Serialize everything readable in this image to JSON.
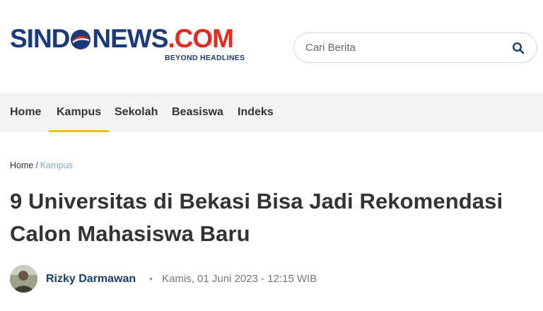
{
  "header": {
    "logo": {
      "part1": "SIND",
      "part2": "NEWS",
      "part3": ".COM",
      "tagline": "BEYOND HEADLINES"
    },
    "search": {
      "placeholder": "Cari Berita",
      "icon": "search-icon"
    }
  },
  "nav": {
    "items": [
      {
        "label": "Home"
      },
      {
        "label": "Kampus",
        "active": true
      },
      {
        "label": "Sekolah"
      },
      {
        "label": "Beasiswa"
      },
      {
        "label": "Indeks"
      }
    ]
  },
  "breadcrumb": {
    "home": "Home",
    "separator": "/",
    "current": "Kampus"
  },
  "article": {
    "title_line1": "9 Universitas di Bekasi Bisa Jadi Rekomendasi",
    "title_line2": "Calon Mahasiswa Baru",
    "author": "Rizky Darmawan",
    "separator": "•",
    "date": "Kamis, 01 Juni 2023 - 12:15 WIB"
  },
  "colors": {
    "brand_blue": "#1a3a7c",
    "brand_red": "#e52a1f",
    "nav_active_underline": "#f2c200",
    "breadcrumb_current": "#7fa9c8"
  }
}
